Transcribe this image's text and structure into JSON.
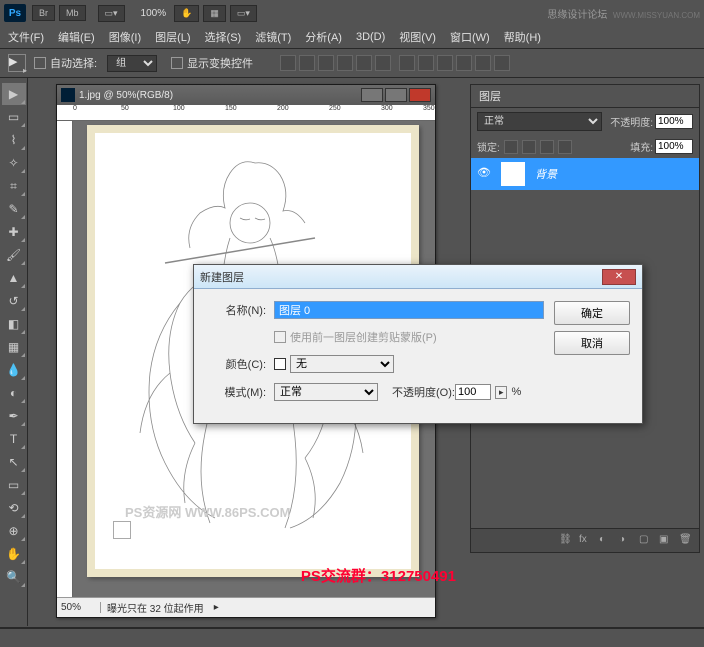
{
  "titlebar": {
    "zoom": "100%",
    "credit": "思缘设计论坛",
    "credit_url": "WWW.MISSYUAN.COM"
  },
  "menus": [
    "文件(F)",
    "编辑(E)",
    "图像(I)",
    "图层(L)",
    "选择(S)",
    "滤镜(T)",
    "分析(A)",
    "3D(D)",
    "视图(V)",
    "窗口(W)",
    "帮助(H)"
  ],
  "optbar": {
    "autosel": "自动选择:",
    "group": "组",
    "transform": "显示变换控件"
  },
  "doc": {
    "title": "1.jpg @ 50%(RGB/8)",
    "zoom": "50%",
    "status": "曝光只在 32 位起作用",
    "watermark": "PS资源网  WWW.86PS.COM"
  },
  "layers": {
    "tab": "图层",
    "blend": "正常",
    "opacity_lbl": "不透明度:",
    "opacity_val": "100%",
    "lock_lbl": "锁定:",
    "fill_lbl": "填充:",
    "fill_val": "100%",
    "layer_name": "背景"
  },
  "dialog": {
    "title": "新建图层",
    "name_lbl": "名称(N):",
    "name_val": "图层 0",
    "clip_lbl": "使用前一图层创建剪贴蒙版(P)",
    "color_lbl": "颜色(C):",
    "color_val": "无",
    "mode_lbl": "模式(M):",
    "mode_val": "正常",
    "op_lbl": "不透明度(O):",
    "op_val": "100",
    "op_suffix": "%",
    "ok": "确定",
    "cancel": "取消"
  },
  "promo": "PS交流群：312750491"
}
